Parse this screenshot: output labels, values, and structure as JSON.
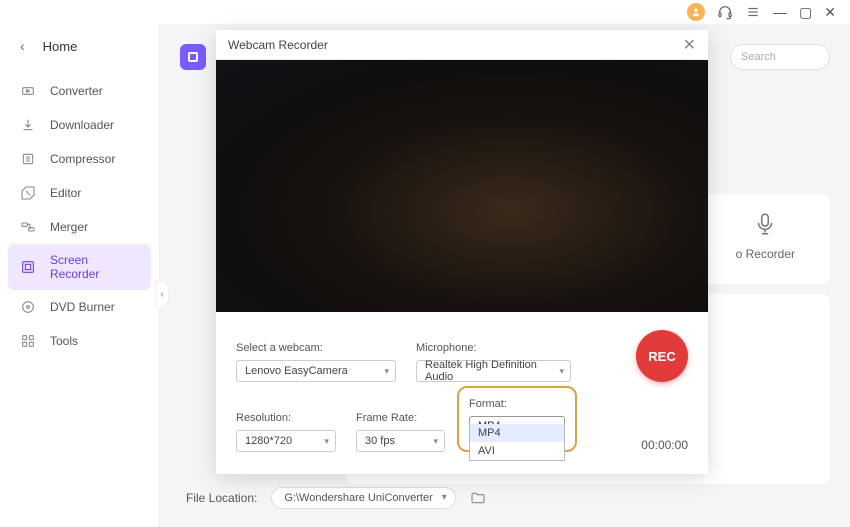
{
  "titlebar": {
    "minimize": "—",
    "maximize": "▢",
    "close": "✕"
  },
  "sidebar": {
    "home": "Home",
    "items": [
      {
        "label": "Converter"
      },
      {
        "label": "Downloader"
      },
      {
        "label": "Compressor"
      },
      {
        "label": "Editor"
      },
      {
        "label": "Merger"
      },
      {
        "label": "Screen Recorder"
      },
      {
        "label": "DVD Burner"
      },
      {
        "label": "Tools"
      }
    ]
  },
  "content": {
    "search_placeholder": "Search",
    "audio_tile": "o Recorder"
  },
  "fileloc": {
    "label": "File Location:",
    "path": "G:\\Wondershare UniConverter"
  },
  "modal": {
    "title": "Webcam Recorder",
    "webcam_label": "Select a webcam:",
    "webcam_value": "Lenovo EasyCamera",
    "mic_label": "Microphone:",
    "mic_value": "Realtek High Definition Audio",
    "res_label": "Resolution:",
    "res_value": "1280*720",
    "fps_label": "Frame Rate:",
    "fps_value": "30 fps",
    "fmt_label": "Format:",
    "fmt_value": "MP4",
    "fmt_options": [
      "MP4",
      "AVI"
    ],
    "rec": "REC",
    "timer": "00:00:00"
  }
}
